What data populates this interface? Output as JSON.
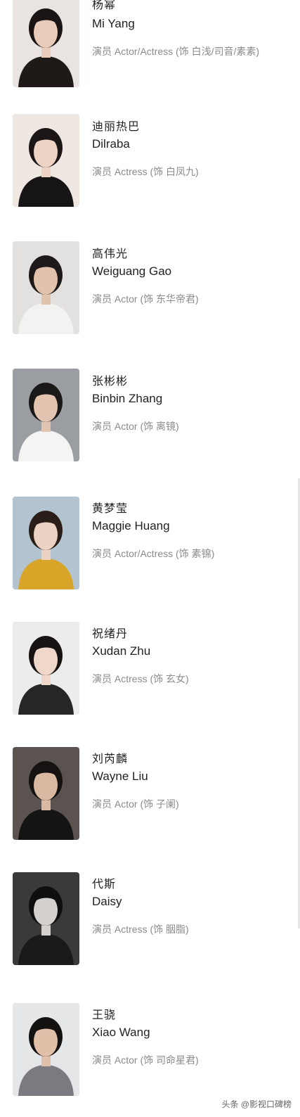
{
  "cast": [
    {
      "name_zh": "杨幂",
      "name_en": "Mi Yang",
      "role": "演员 Actor/Actress (饰 白浅/司音/素素)",
      "bg": "#e9e4e1",
      "skin": "#e8cbb8",
      "hair": "#1a1414",
      "cloth": "#1f1a18"
    },
    {
      "name_zh": "迪丽热巴",
      "name_en": "Dilraba",
      "role": "演员 Actress (饰 白凤九)",
      "bg": "#efe7e2",
      "skin": "#ecd3c4",
      "hair": "#1c1616",
      "cloth": "#161414"
    },
    {
      "name_zh": "高伟光",
      "name_en": "Weiguang Gao",
      "role": "演员 Actor (饰 东华帝君)",
      "bg": "#e3e1df",
      "skin": "#e1c2ad",
      "hair": "#1d1919",
      "cloth": "#f2f2f0"
    },
    {
      "name_zh": "张彬彬",
      "name_en": "Binbin Zhang",
      "role": "演员 Actor (饰 离镜)",
      "bg": "#9a9da2",
      "skin": "#e2c4b0",
      "hair": "#1b1818",
      "cloth": "#f4f4f2"
    },
    {
      "name_zh": "黄梦莹",
      "name_en": "Maggie Huang",
      "role": "演员 Actor/Actress (饰 素锦)",
      "bg": "#b3c3cf",
      "skin": "#ecd2c2",
      "hair": "#2a1e18",
      "cloth": "#d8a528"
    },
    {
      "name_zh": "祝绪丹",
      "name_en": "Xudan Zhu",
      "role": "演员 Actress (饰 玄女)",
      "bg": "#ececec",
      "skin": "#efd8ca",
      "hair": "#171313",
      "cloth": "#262626"
    },
    {
      "name_zh": "刘芮麟",
      "name_en": "Wayne Liu",
      "role": "演员 Actor (饰 子阑)",
      "bg": "#5a5350",
      "skin": "#d9b8a2",
      "hair": "#161212",
      "cloth": "#141414"
    },
    {
      "name_zh": "代斯",
      "name_en": "Daisy",
      "role": "演员 Actress (饰 胭脂)",
      "bg": "#3a3a3a",
      "skin": "#d4d0cd",
      "hair": "#0f0f0f",
      "cloth": "#1a1a1a"
    },
    {
      "name_zh": "王骁",
      "name_en": "Xiao Wang",
      "role": "演员 Actor (饰 司命星君)",
      "bg": "#e4e6e8",
      "skin": "#e0c0a8",
      "hair": "#141111",
      "cloth": "#7a7a80"
    }
  ],
  "watermark": "头条 @影视口碑榜"
}
